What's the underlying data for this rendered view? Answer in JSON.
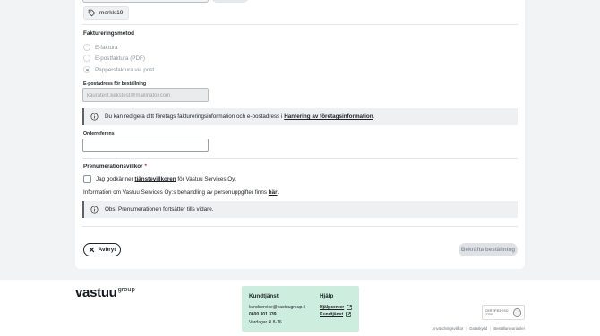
{
  "tag": {
    "label": "merkki19",
    "icon": "tag-icon"
  },
  "billing": {
    "title": "Faktureringsmetod",
    "options": [
      {
        "label": "E-faktura",
        "selected": false
      },
      {
        "label": "E-postfaktura (PDF)",
        "selected": false
      },
      {
        "label": "Pappersfaktura via post",
        "selected": true
      }
    ]
  },
  "email": {
    "label": "E-postadress för beställning",
    "value": "kauratest.kekstest@mailinator.com"
  },
  "info_company": {
    "text_before": "Du kan redigera ditt företags faktureringsinformation och e-postadress i",
    "link": "Hantering av företagsinformation",
    "text_after": "."
  },
  "order_ref": {
    "label": "Orderreferens",
    "value": ""
  },
  "subscription": {
    "title": "Prenumerationsvillkor",
    "required_mark": "*",
    "terms_before": "Jag godkänner",
    "terms_link": "tjänstevillkoren",
    "terms_after": "för Vastuu Services Oy.",
    "privacy_before": "Information om Vastuu Services Oy:s behandling av personuppgifter finns",
    "privacy_link": "här",
    "privacy_after": "."
  },
  "info_notice": {
    "text": "Obs! Prenumerationen fortsätter tills vidare."
  },
  "actions": {
    "cancel": "Avbryt",
    "confirm": "Bekräfta beställning"
  },
  "footer": {
    "logo_main": "vastuu",
    "logo_sup": "group",
    "support": {
      "title": "Kundtjänst",
      "email": "kundservice@vastuugroup.fi",
      "phone": "0600 301 339",
      "hours": "Vardagar kl 8-16"
    },
    "help": {
      "title": "Hjälp",
      "links": [
        "Hjälpcenter",
        "Kundtjänst"
      ]
    },
    "iso_badge": "CERTIFIED ISO 27001",
    "bottom_links": [
      "Användningsvillkor",
      "Dataskydd",
      "Beställarevariabler"
    ]
  },
  "colors": {
    "accent": "#c8202f",
    "support_box": "#cdeede"
  }
}
